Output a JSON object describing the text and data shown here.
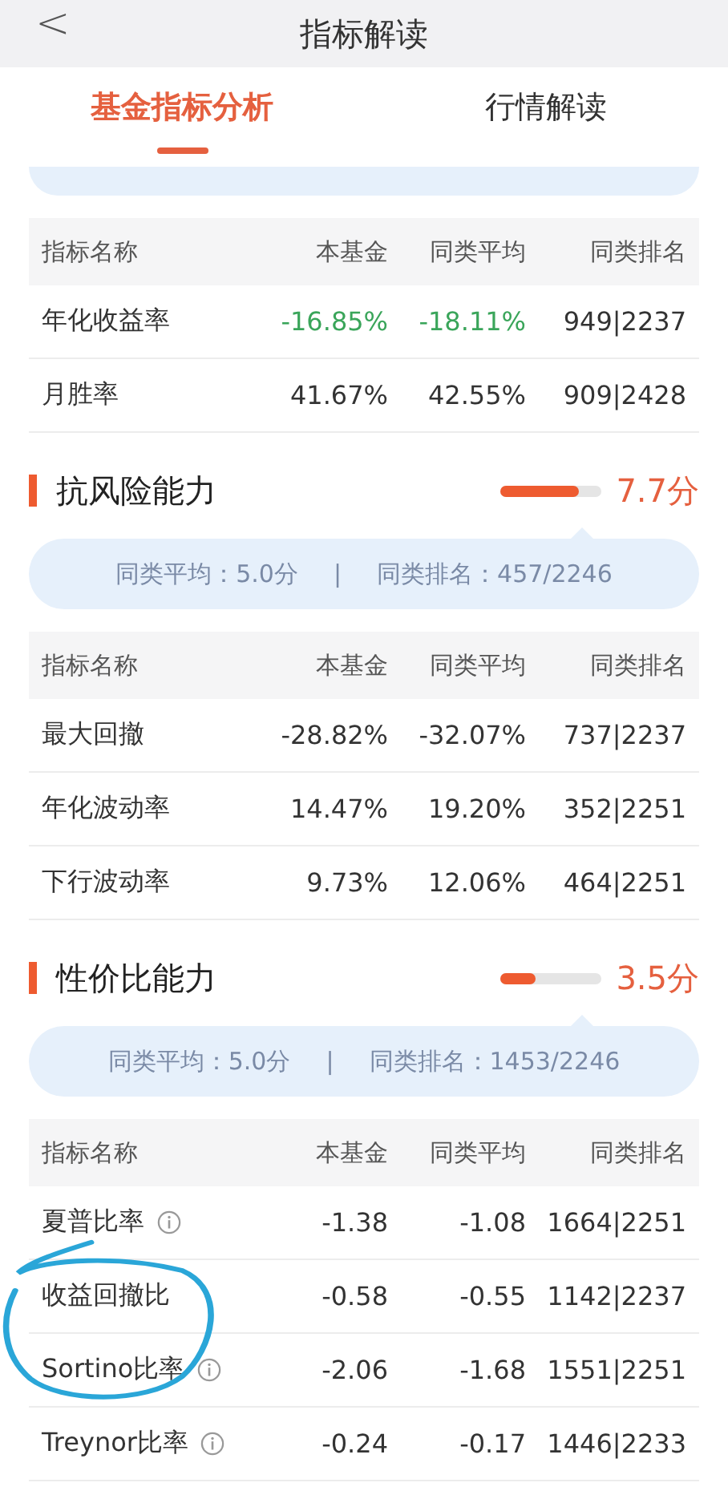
{
  "header": {
    "back": "<",
    "title": "指标解读"
  },
  "tabs": [
    {
      "label": "基金指标分析",
      "selected": true
    },
    {
      "label": "行情解读",
      "selected": false
    }
  ],
  "partial_bubble": true,
  "sections": [
    {
      "table": {
        "columns": [
          "指标名称",
          "本基金",
          "同类平均",
          "同类排名"
        ],
        "rows": [
          {
            "name": "年化收益率",
            "info": false,
            "negative_return": true,
            "fund": "-16.85%",
            "avg": "-18.11%",
            "rank": "949|2237"
          },
          {
            "name": "月胜率",
            "info": false,
            "negative_return": false,
            "fund": "41.67%",
            "avg": "42.55%",
            "rank": "909|2428"
          }
        ]
      }
    },
    {
      "title": "抗风险能力",
      "level": 0.77,
      "score": "7.7分",
      "avg": "同类平均：5.0分",
      "divider": "|",
      "rank": "同类排名：457/2246",
      "table": {
        "columns": [
          "指标名称",
          "本基金",
          "同类平均",
          "同类排名"
        ],
        "rows": [
          {
            "name": "最大回撤",
            "info": false,
            "negative_return": false,
            "fund": "-28.82%",
            "avg": "-32.07%",
            "rank": "737|2237"
          },
          {
            "name": "年化波动率",
            "info": false,
            "negative_return": false,
            "fund": "14.47%",
            "avg": "19.20%",
            "rank": "352|2251"
          },
          {
            "name": "下行波动率",
            "info": false,
            "negative_return": false,
            "fund": "9.73%",
            "avg": "12.06%",
            "rank": "464|2251"
          }
        ]
      }
    },
    {
      "title": "性价比能力",
      "level": 0.35,
      "score": "3.5分",
      "avg": "同类平均：5.0分",
      "divider": "|",
      "rank": "同类排名：1453/2246",
      "table": {
        "columns": [
          "指标名称",
          "本基金",
          "同类平均",
          "同类排名"
        ],
        "rows": [
          {
            "name": "夏普比率",
            "info": true,
            "negative_return": false,
            "fund": "-1.38",
            "avg": "-1.08",
            "rank": "1664|2251"
          },
          {
            "name": "收益回撤比",
            "info": false,
            "negative_return": false,
            "fund": "-0.58",
            "avg": "-0.55",
            "rank": "1142|2237"
          },
          {
            "name": "Sortino比率",
            "info": true,
            "negative_return": false,
            "fund": "-2.06",
            "avg": "-1.68",
            "rank": "1551|2251"
          },
          {
            "name": "Treynor比率",
            "info": true,
            "negative_return": false,
            "fund": "-0.24",
            "avg": "-0.17",
            "rank": "1446|2233"
          }
        ]
      }
    }
  ],
  "hand_circle": true
}
